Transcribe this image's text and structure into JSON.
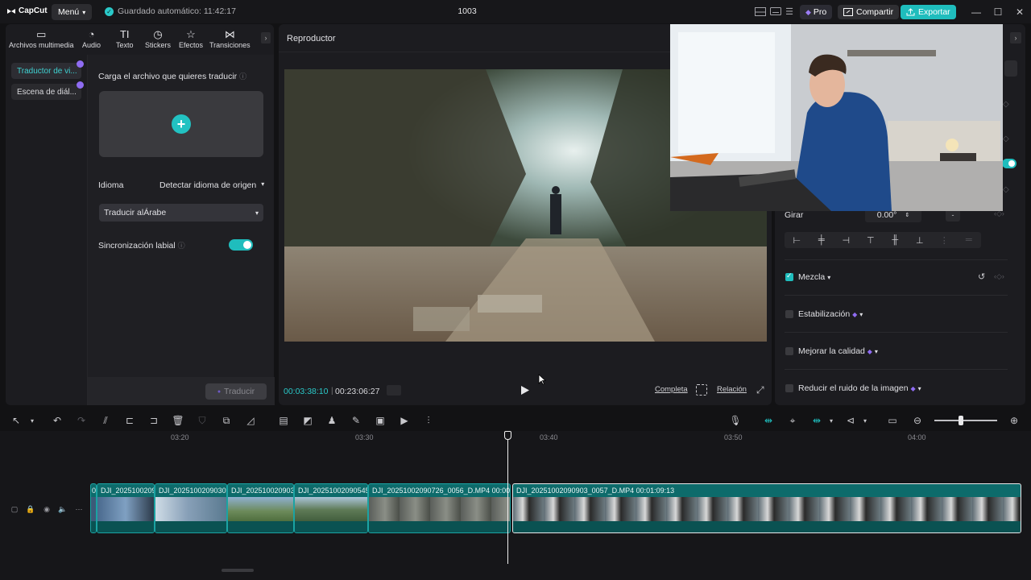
{
  "topbar": {
    "logo": "CapCut",
    "menu_label": "Menú",
    "autosave": "Guardado automático: 11:42:17",
    "project_title": "1003",
    "pro_label": "Pro",
    "share_label": "Compartir",
    "export_label": "Exportar"
  },
  "media_tabs": [
    {
      "label": "Archivos multimedia",
      "icon": "media-icon"
    },
    {
      "label": "Audio",
      "icon": "audio-icon"
    },
    {
      "label": "Texto",
      "icon": "text-icon"
    },
    {
      "label": "Stickers",
      "icon": "sticker-icon"
    },
    {
      "label": "Efectos",
      "icon": "effects-icon"
    },
    {
      "label": "Transiciones",
      "icon": "transitions-icon"
    }
  ],
  "sidenav": [
    {
      "label": "Traductor de vi...",
      "active": true
    },
    {
      "label": "Escena de diál...",
      "active": false
    }
  ],
  "translator": {
    "upload_label": "Carga el archivo que quieres traducir",
    "language_label": "Idioma",
    "detect_label": "Detectar idioma de origen",
    "target_select": "Traducir alÁrabe",
    "lipsync_label": "Sincronización labial",
    "lipsync_on": true,
    "translate_button": "Traducir"
  },
  "player": {
    "title": "Reproductor",
    "current_time": "00:03:38:10",
    "total_time": "00:23:06:27",
    "full_label": "Completa",
    "ratio_label": "Relación"
  },
  "properties": {
    "rotate_label": "Girar",
    "rotate_value": "0.00°",
    "blend_label": "Mezcla",
    "blend_checked": true,
    "stabilize_label": "Estabilización",
    "enhance_label": "Mejorar la calidad",
    "denoise_label": "Reducir el ruido de la imagen"
  },
  "timeline": {
    "ruler_labels": [
      "03:20",
      "03:30",
      "03:40",
      "03:50",
      "04:00"
    ],
    "clips": [
      {
        "name": "0("
      },
      {
        "name": "DJI_2025100209"
      },
      {
        "name": "DJI_20251002090307"
      },
      {
        "name": "DJI_2025100209030"
      },
      {
        "name": "DJI_20251002090545"
      },
      {
        "name": "DJI_20251002090726_0056_D.MP4   00:00:0"
      },
      {
        "name": "DJI_20251002090903_0057_D.MP4   00:01:09:13"
      }
    ]
  },
  "colors": {
    "accent": "#1fbdbd",
    "clip": "#0d6b6b",
    "pro_badge": "#8f6cf2"
  }
}
